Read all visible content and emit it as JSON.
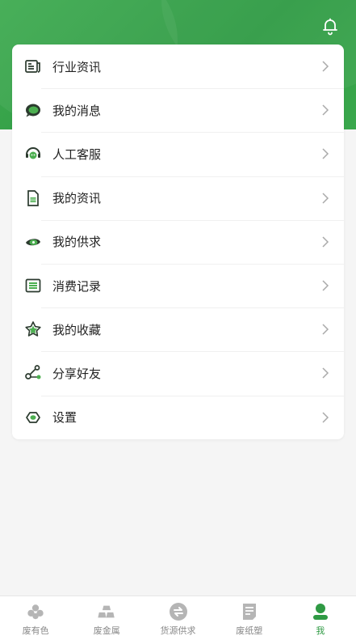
{
  "header": {
    "bell_icon": "bell-icon"
  },
  "menu": [
    {
      "label": "行业资讯",
      "icon": "news-icon"
    },
    {
      "label": "我的消息",
      "icon": "message-icon"
    },
    {
      "label": "人工客服",
      "icon": "headset-icon"
    },
    {
      "label": "我的资讯",
      "icon": "document-icon"
    },
    {
      "label": "我的供求",
      "icon": "eye-icon"
    },
    {
      "label": "消费记录",
      "icon": "list-icon"
    },
    {
      "label": "我的收藏",
      "icon": "star-icon"
    },
    {
      "label": "分享好友",
      "icon": "share-icon"
    },
    {
      "label": "设置",
      "icon": "settings-icon"
    }
  ],
  "tabs": [
    {
      "label": "废有色",
      "icon": "nonferrous-icon",
      "active": false
    },
    {
      "label": "废金属",
      "icon": "metal-icon",
      "active": false
    },
    {
      "label": "货源供求",
      "icon": "exchange-icon",
      "active": false
    },
    {
      "label": "废纸塑",
      "icon": "paper-icon",
      "active": false
    },
    {
      "label": "我",
      "icon": "user-icon",
      "active": true
    }
  ],
  "colors": {
    "brand": "#2f9a44",
    "icon_dark": "#2b3a2e",
    "icon_accent": "#4caf50"
  }
}
